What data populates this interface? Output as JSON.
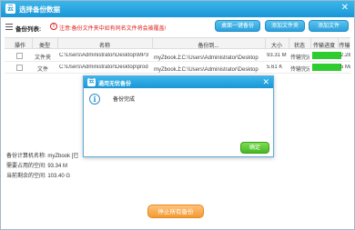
{
  "window": {
    "title": "选择备份数据",
    "logo_glyph": "云",
    "close_glyph": "✕"
  },
  "toolbar": {
    "list_label": "备份列表:",
    "warning": "注意:备份文件夹中如有同名文件将会被覆盖!",
    "buttons": [
      "桌面一键备份",
      "添加文件夹",
      "添加文件"
    ]
  },
  "table": {
    "columns": [
      "操作",
      "类型",
      "名称",
      "备份到...",
      "大小",
      "状态",
      "传输进度",
      "传输"
    ],
    "rows": [
      {
        "type": "文件夹",
        "name": "C:\\Users\\Administrator\\Desktop\\MP3",
        "dest": "myZbook上C:\\Users\\Administrator\\Desktop",
        "size": "93.31 M",
        "status": "传输完成",
        "progress": 1.0,
        "speed": "2.28"
      },
      {
        "type": "文件",
        "name": "C:\\Users\\Administrator\\Desktop\\prod",
        "dest": "myZbook上C:\\Users\\Administrator\\Desktop",
        "size": "5.61 K",
        "status": "传输完成",
        "progress": 1.0,
        "speed": "5 M/"
      }
    ]
  },
  "info": {
    "computer": "备份计算机名称: myZbook [已",
    "needed": "需要占用的空间: 93.34 M",
    "remaining": "当前剩余的空间: 103.40 G"
  },
  "stop_button": "停止所有备份",
  "dialog": {
    "title": "通用无忧备份",
    "message": "备份完成",
    "ok": "确定",
    "info_glyph": "i",
    "close_glyph": "✕"
  },
  "colors": {
    "accent": "#1a96d6",
    "warning": "#e02020",
    "progress": "#2ecc2e",
    "ok": "#45b823",
    "stop": "#f39a34"
  }
}
